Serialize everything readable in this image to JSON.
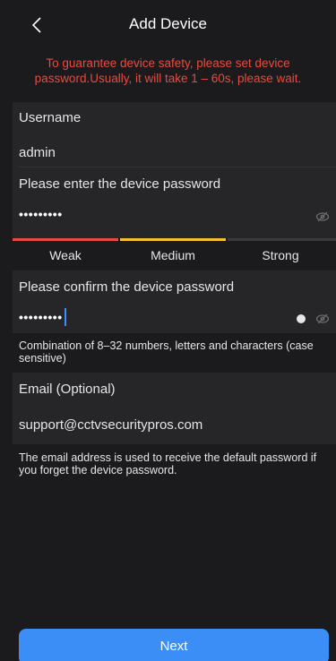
{
  "header": {
    "title": "Add Device",
    "back_icon": "chevron-left-icon"
  },
  "notice": {
    "text": "To guarantee device safety, please set device password.Usually, it will take 1 – 60s, please wait.",
    "color": "#e84a3f"
  },
  "username": {
    "label": "Username",
    "value": "admin"
  },
  "password": {
    "label": "Please enter the device password",
    "masked_value": "•••••••••",
    "toggle_icon": "eye-hidden-icon"
  },
  "strength": {
    "levels": [
      "Weak",
      "Medium",
      "Strong"
    ],
    "colors": [
      "#e84a3f",
      "#f2c230",
      "#3a3a3c"
    ],
    "current_level": "Medium"
  },
  "confirm_password": {
    "label": "Please confirm the device password",
    "masked_value": "•••••••••",
    "clear_icon": "clear-dot-icon",
    "toggle_icon": "eye-hidden-icon"
  },
  "password_hint": "Combination of 8–32 numbers, letters and characters (case sensitive)",
  "email": {
    "label": "Email (Optional)",
    "value": "support@cctvsecuritypros.com"
  },
  "email_hint": "The email address is used to receive the default password if you forget the device password.",
  "next_button": {
    "label": "Next",
    "color": "#3a8ef6"
  }
}
